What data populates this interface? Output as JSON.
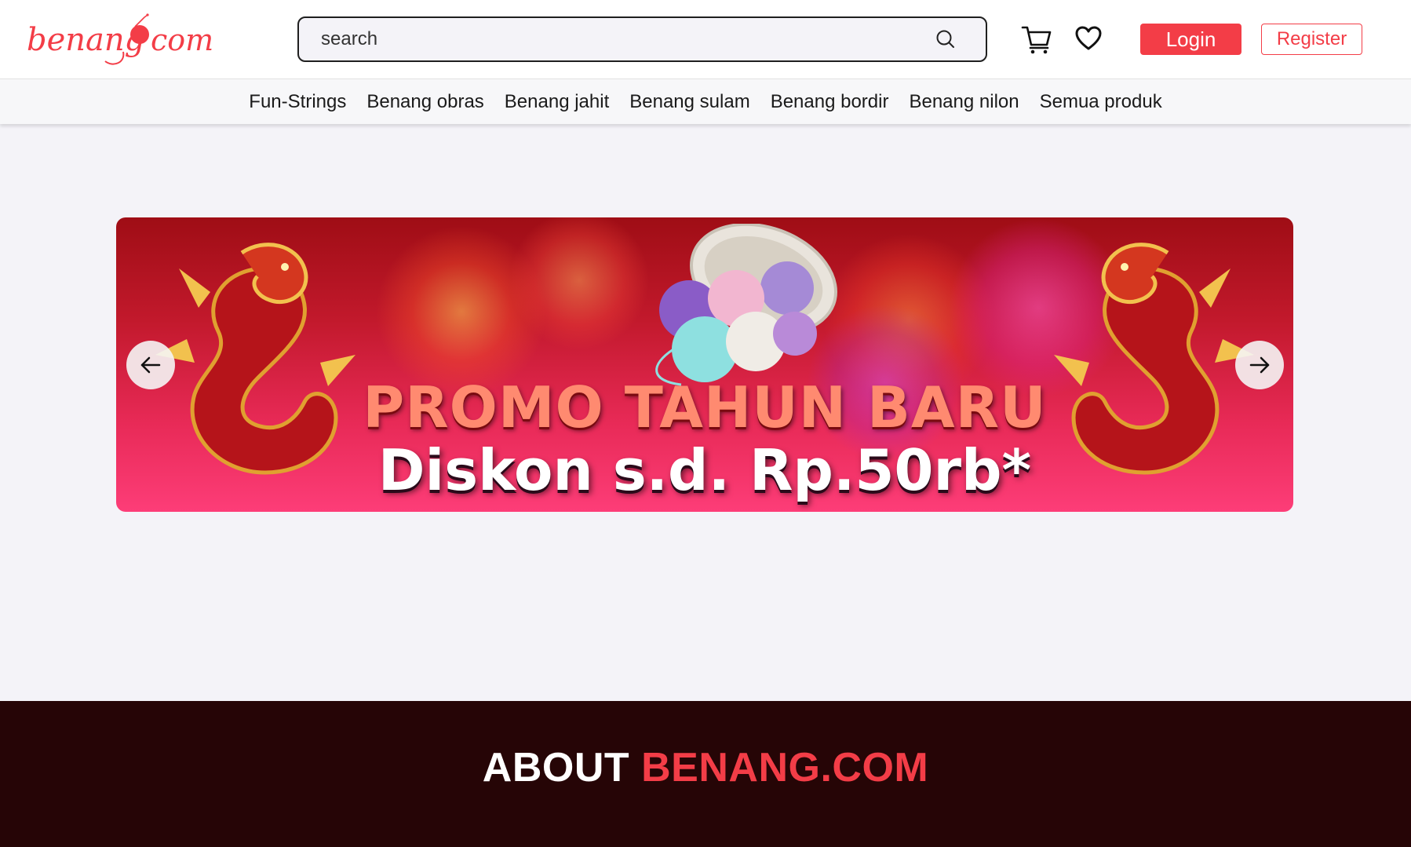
{
  "header": {
    "logo": {
      "text_left": "benang",
      "text_right": "com",
      "alt": "benang.com"
    },
    "search": {
      "placeholder": "search"
    },
    "login_label": "Login",
    "register_label": "Register"
  },
  "icons": {
    "search": "search-icon",
    "cart": "cart-icon",
    "wishlist": "heart-icon",
    "prev": "arrow-left-icon",
    "next": "arrow-right-icon"
  },
  "nav": {
    "categories": [
      "Fun-Strings",
      "Benang obras",
      "Benang jahit",
      "Benang sulam",
      "Benang bordir",
      "Benang nilon",
      "Semua produk"
    ]
  },
  "banner": {
    "title": "PROMO TAHUN BARU",
    "subtitle": "Diskon s.d. Rp.50rb*"
  },
  "about": {
    "title_white": "ABOUT ",
    "title_red": "BENANG.COM"
  },
  "colors": {
    "brand": "#f33d47",
    "about_bg": "#260506",
    "page_bg": "#f4f3f8"
  }
}
